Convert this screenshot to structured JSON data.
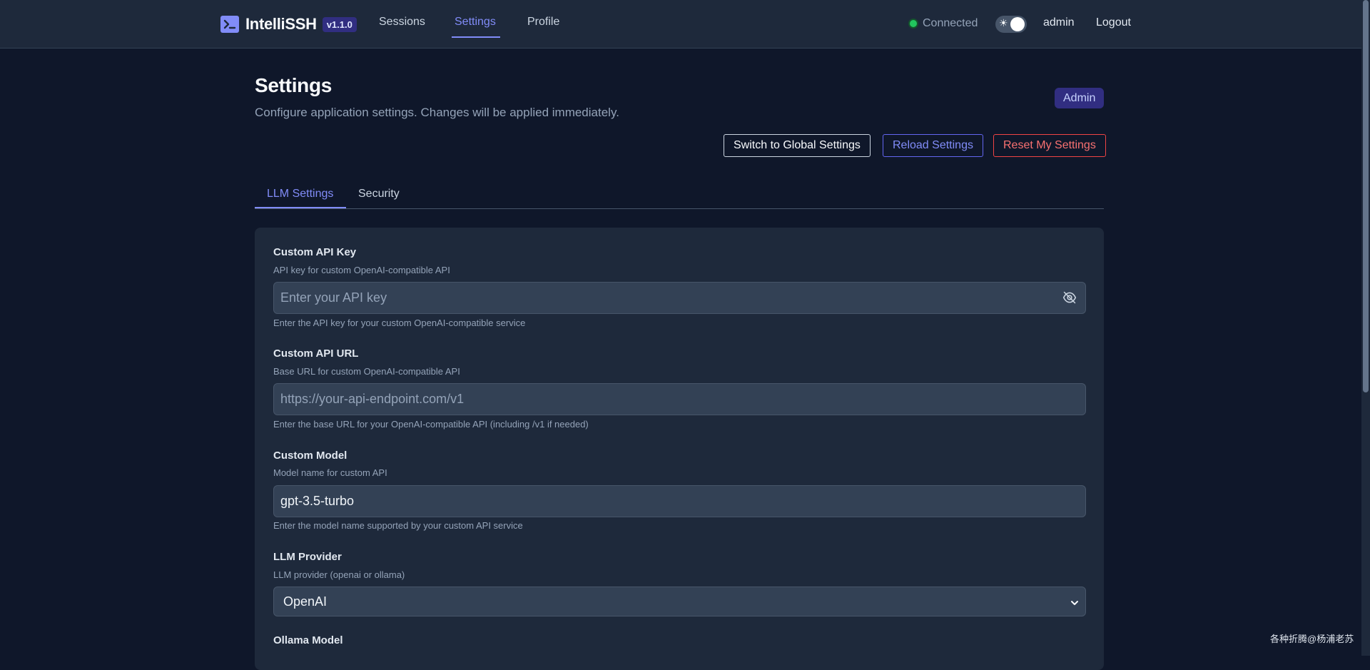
{
  "nav": {
    "brand": "IntelliSSH",
    "version": "v1.1.0",
    "links": [
      "Sessions",
      "Settings",
      "Profile"
    ],
    "active_link": "Settings",
    "connection_status": "Connected",
    "status_color": "#22c55e",
    "theme_toggle_icon": "☀",
    "user": "admin",
    "logout": "Logout"
  },
  "header": {
    "title": "Settings",
    "subtitle": "Configure application settings. Changes will be applied immediately.",
    "role_badge": "Admin"
  },
  "actions": {
    "switch_global": "Switch to Global Settings",
    "reload": "Reload Settings",
    "reset": "Reset My Settings"
  },
  "tabs": [
    {
      "label": "LLM Settings",
      "active": true
    },
    {
      "label": "Security",
      "active": false
    }
  ],
  "fields": [
    {
      "label": "Custom API Key",
      "description": "API key for custom OpenAI-compatible API",
      "value": "",
      "placeholder": "Enter your API key",
      "help": "Enter the API key for your custom OpenAI-compatible service",
      "icon": "eye-off-icon"
    },
    {
      "label": "Custom API URL",
      "description": "Base URL for custom OpenAI-compatible API",
      "value": "",
      "placeholder": "https://your-api-endpoint.com/v1",
      "help": "Enter the base URL for your OpenAI-compatible API (including /v1 if needed)"
    },
    {
      "label": "Custom Model",
      "description": "Model name for custom API",
      "value": "gpt-3.5-turbo",
      "help": "Enter the model name supported by your custom API service"
    },
    {
      "label": "LLM Provider",
      "description": "LLM provider (openai or ollama)",
      "selected": "OpenAI"
    },
    {
      "label": "Ollama Model"
    }
  ],
  "watermark": "各种折腾@杨浦老苏",
  "colors": {
    "background": "#0f172a",
    "surface": "#1e293b",
    "accent": "#818cf8",
    "danger": "#f87171"
  }
}
